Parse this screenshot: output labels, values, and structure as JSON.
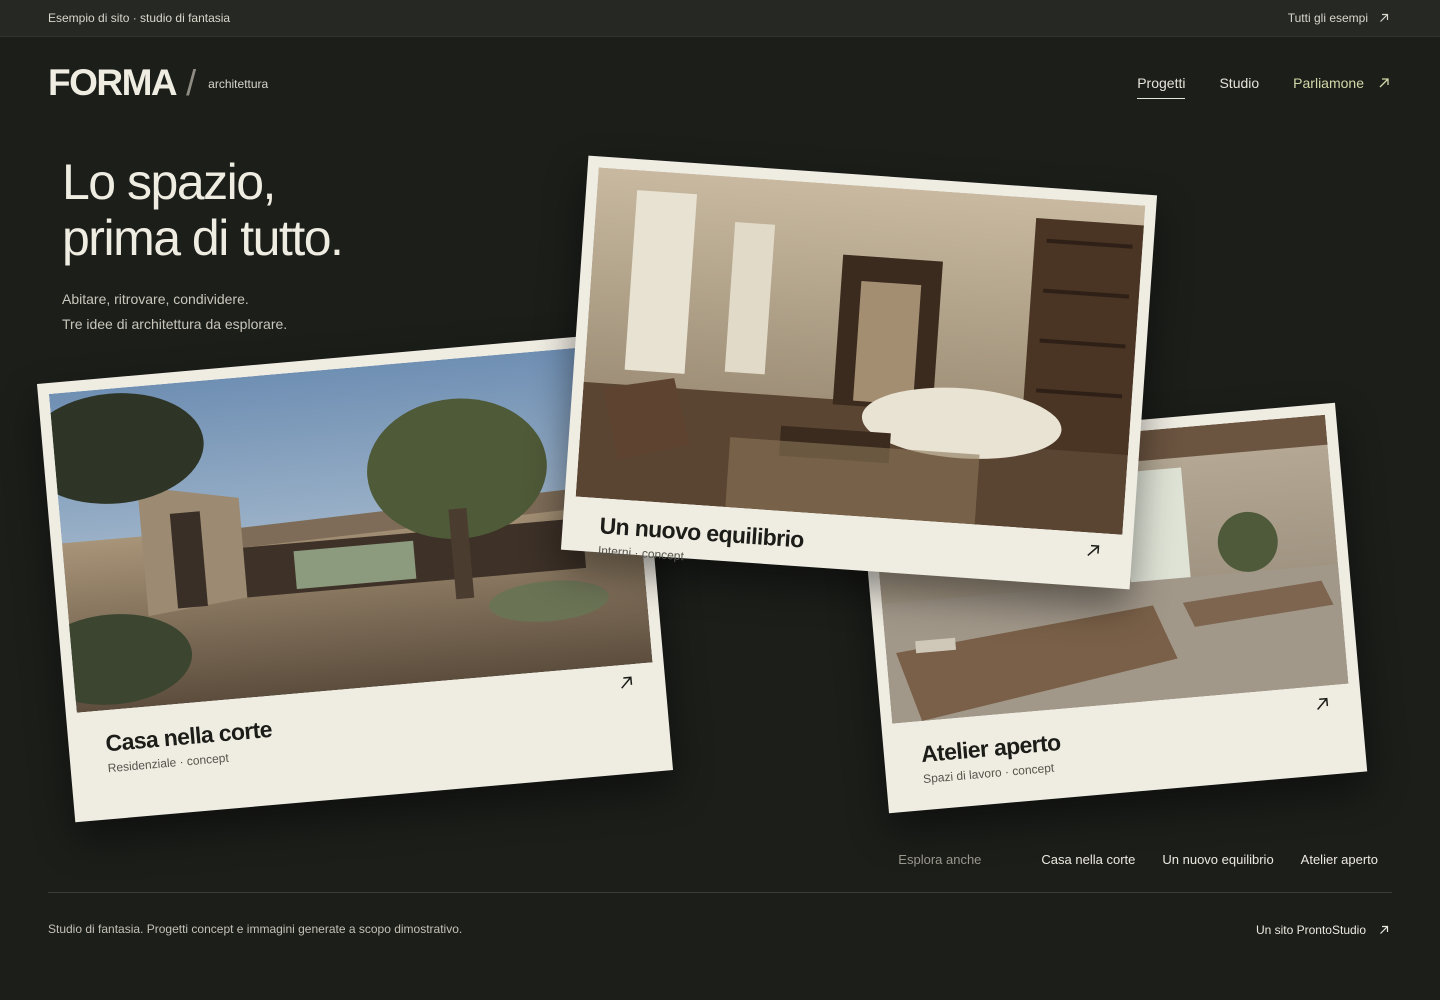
{
  "topbar": {
    "left_text": "Esempio di sito · studio di fantasia",
    "right_link": "Tutti gli esempi",
    "right_icon": "arrow-up-right-icon"
  },
  "brand": {
    "name": "FORMA",
    "separator": "/",
    "subtitle": "architettura"
  },
  "nav": {
    "items": [
      {
        "label": "Progetti",
        "active": true
      },
      {
        "label": "Studio",
        "active": false
      }
    ],
    "cta": {
      "label": "Parliamone",
      "icon": "arrow-up-right-icon"
    }
  },
  "hero": {
    "headline_line1": "Lo spazio,",
    "headline_line2": "prima di tutto.",
    "lead_line1": "Abitare, ritrovare, condividere.",
    "lead_line2": "Tre idee di architettura da esplorare."
  },
  "projects": [
    {
      "title": "Casa nella corte",
      "tag": "Residenziale · concept",
      "icon": "arrow-up-right-icon"
    },
    {
      "title": "Un nuovo equilibrio",
      "tag": "Interni · concept",
      "icon": "arrow-up-right-icon"
    },
    {
      "title": "Atelier aperto",
      "tag": "Spazi di lavoro · concept",
      "icon": "arrow-up-right-icon"
    }
  ],
  "explore": {
    "label": "Esplora anche",
    "links": [
      "Casa nella corte",
      "Un nuovo equilibrio",
      "Atelier aperto"
    ]
  },
  "footer": {
    "note": "Studio di fantasia. Progetti concept e immagini generate a scopo dimostrativo.",
    "credit": "Un sito ProntoStudio",
    "credit_icon": "arrow-up-right-icon"
  },
  "colors": {
    "background": "#1c1e1a",
    "card": "#efece2",
    "accent": "#d3d8a8",
    "text": "#e9e6dc"
  }
}
